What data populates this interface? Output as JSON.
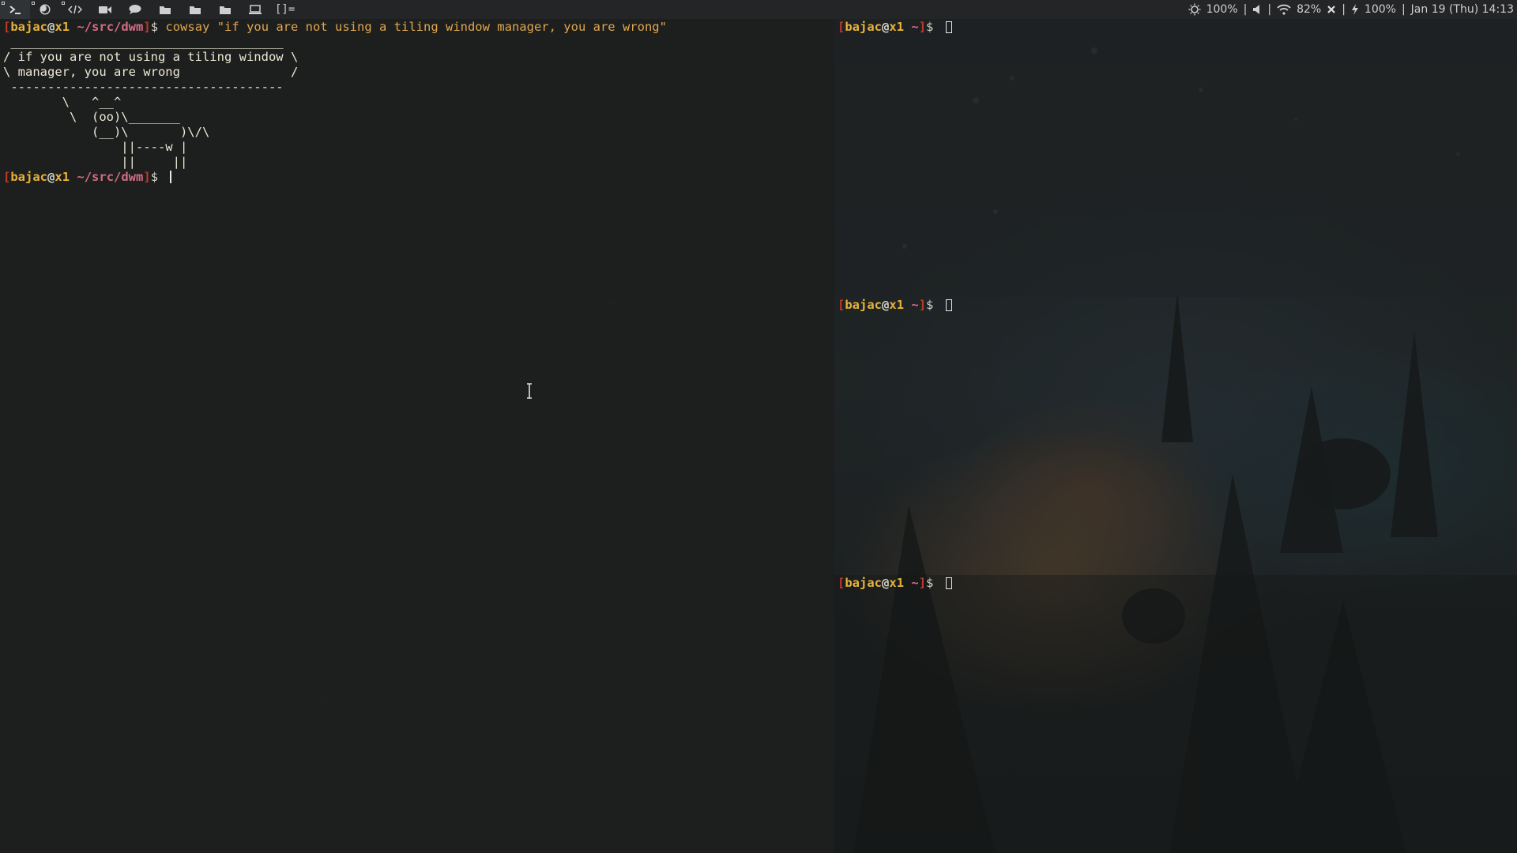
{
  "topbar": {
    "tags": [
      {
        "icon": "terminal-icon"
      },
      {
        "icon": "firefox-icon"
      },
      {
        "icon": "code-icon"
      },
      {
        "icon": "video-camera-icon"
      },
      {
        "icon": "chat-icon"
      },
      {
        "icon": "folder-icon"
      },
      {
        "icon": "folder-icon"
      },
      {
        "icon": "folder-icon"
      },
      {
        "icon": "laptop-icon"
      }
    ],
    "layout_symbol": "[]=",
    "status": {
      "brightness": "100%",
      "volume_icon": "speaker-icon",
      "wifi": "82%",
      "bluetooth_icon": "close-icon",
      "battery": "100%",
      "datetime": "Jan 19 (Thu) 14:13",
      "separator": "|"
    }
  },
  "terminals": {
    "main": {
      "prompt": {
        "open": "[",
        "user": "bajac",
        "at": "@",
        "host": "x1",
        "path": " ~/src/dwm",
        "close": "]",
        "dollar": "$ "
      },
      "command": "cowsay \"if you are not using a tiling window manager, you are wrong\"",
      "output": [
        " _____________________________________",
        "/ if you are not using a tiling window \\",
        "\\ manager, you are wrong               /",
        " -------------------------------------",
        "        \\   ^__^",
        "         \\  (oo)\\_______",
        "            (__)\\       )\\/\\",
        "                ||----w |",
        "                ||     ||"
      ]
    },
    "right": {
      "prompt": {
        "open": "[",
        "user": "bajac",
        "at": "@",
        "host": "x1",
        "path": " ~",
        "close": "]",
        "dollar": "$ "
      }
    }
  },
  "colors": {
    "prompt_bracket": "#c0392b",
    "prompt_user": "#e8b23a",
    "prompt_path": "#d36b84",
    "command": "#e0a64f"
  }
}
